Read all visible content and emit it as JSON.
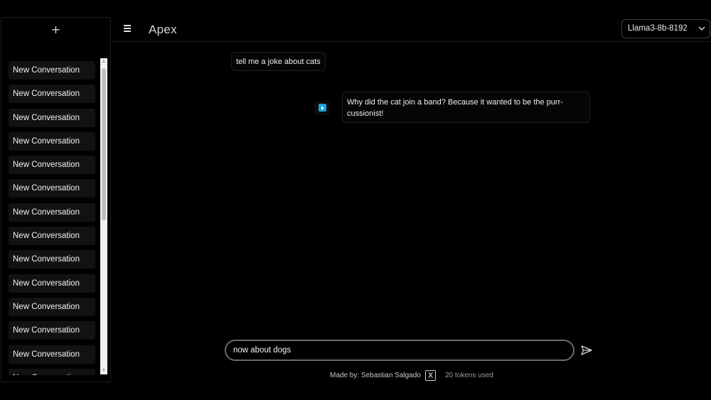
{
  "sidebar": {
    "new_button": "+",
    "conversations": [
      "New Conversation",
      "New Conversation",
      "New Conversation",
      "New Conversation",
      "New Conversation",
      "New Conversation",
      "New Conversation",
      "New Conversation",
      "New Conversation",
      "New Conversation",
      "New Conversation",
      "New Conversation",
      "New Conversation",
      "New Conversation"
    ]
  },
  "header": {
    "title": "Apex",
    "model": "Llama3-8b-8192"
  },
  "messages": {
    "user": "tell me a joke about cats",
    "assistant": "Why did the cat join a band? Because it wanted to be the purr-cussionist!"
  },
  "input": {
    "value": "now about dogs"
  },
  "footer": {
    "author": "Made by: Sebastian Salgado",
    "x_glyph": "X",
    "tokens": "20 tokens used"
  },
  "colors": {
    "background": "#000000",
    "avatar_accent": "#1aa1e0"
  },
  "icons": {
    "menu": "hamburger-menu-icon",
    "send": "send-icon",
    "social": "x-logo-icon",
    "assistant_avatar": "play-icon"
  }
}
